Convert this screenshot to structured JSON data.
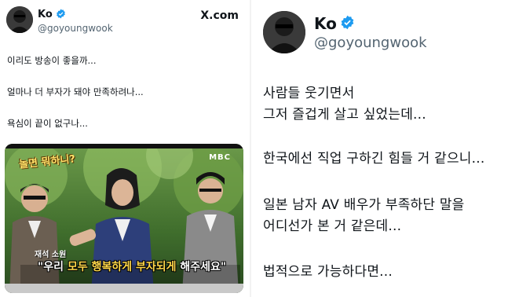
{
  "left": {
    "display_name": "Ko",
    "handle": "@goyoungwook",
    "site_label": "X.com",
    "tweet_lines": [
      "이리도 방송이 좋을까...",
      "얼마나 더 부자가 돼야 만족하려나...",
      "욕심이 끝이 없구나..."
    ],
    "image": {
      "show_logo": "놀면 뭐하니?",
      "channel": "MBC",
      "caption_small": "재석 소원",
      "caption_open": "\"우리 ",
      "caption_highlight": "모두 행복하게 부자되게",
      "caption_close": " 해주세요\""
    }
  },
  "right": {
    "display_name": "Ko",
    "handle": "@goyoungwook",
    "tweet_lines": [
      "사람들 웃기면서",
      "그저 즐겁게 살고 싶었는데...",
      "한국에선 직업 구하긴 힘들 거 같으니...",
      "일본 남자 AV 배우가 부족하단 말을",
      "어디선가 본 거 같은데...",
      "법적으로 가능하다면..."
    ]
  },
  "colors": {
    "verified_blue": "#1d9bf0",
    "handle_gray": "#536471",
    "text": "#0f1419"
  }
}
